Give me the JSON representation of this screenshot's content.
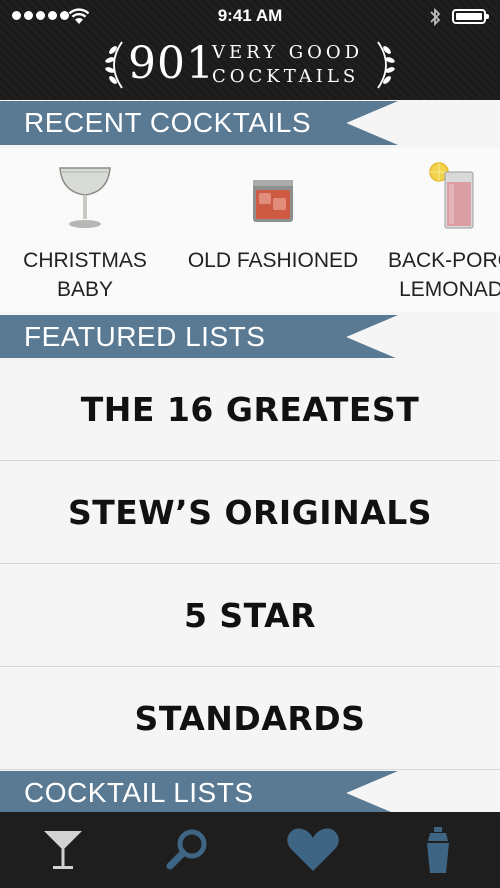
{
  "status_bar": {
    "time": "9:41 AM"
  },
  "logo": {
    "number": "901",
    "line1": "VERY GOOD",
    "line2": "COCKTAILS"
  },
  "sections": {
    "recent": "RECENT COCKTAILS",
    "featured": "FEATURED LISTS",
    "cocktail_lists": "COCKTAIL LISTS"
  },
  "recent_cocktails": [
    {
      "name_line1": "CHRISTMAS",
      "name_line2": "BABY",
      "icon": "coupe-glass-icon"
    },
    {
      "name_line1": "OLD FASHIONED",
      "name_line2": "",
      "icon": "rocks-glass-icon"
    },
    {
      "name_line1": "BACK-PORCH",
      "name_line2": "LEMONADE",
      "icon": "highball-glass-icon"
    }
  ],
  "featured_lists": [
    "THE 16 GREATEST",
    "STEW’S ORIGINALS",
    "5 STAR",
    "STANDARDS"
  ],
  "tabs": [
    {
      "name": "cocktails",
      "icon": "martini-glass-icon"
    },
    {
      "name": "search",
      "icon": "search-icon"
    },
    {
      "name": "favorites",
      "icon": "heart-icon"
    },
    {
      "name": "bar",
      "icon": "shaker-icon"
    }
  ],
  "colors": {
    "banner": "#5a7a94",
    "tab_inactive": "#3f6585",
    "tab_active": "#d2d2d2",
    "header": "#1b1b1b"
  }
}
